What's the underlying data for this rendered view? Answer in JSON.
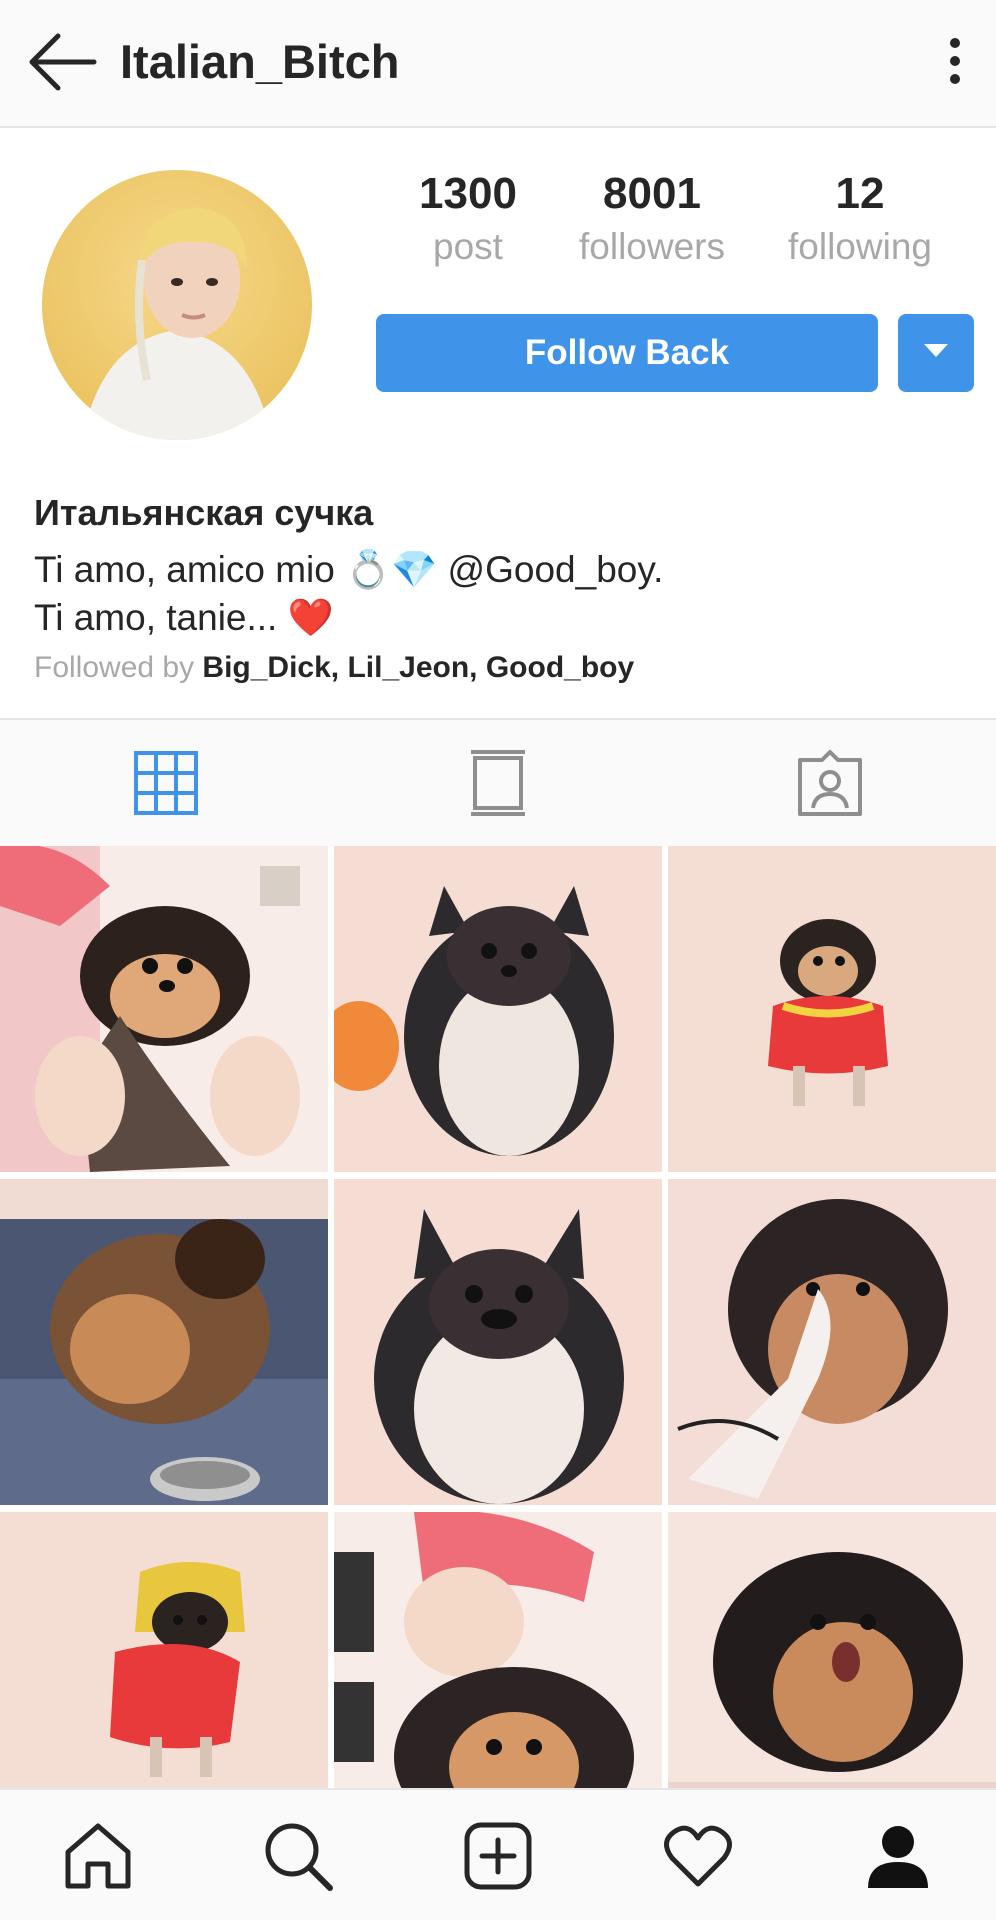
{
  "header": {
    "username": "Italian_Bitch"
  },
  "profile": {
    "stats": [
      {
        "value": "1300",
        "label": "post"
      },
      {
        "value": "8001",
        "label": "followers"
      },
      {
        "value": "12",
        "label": "following"
      }
    ],
    "follow_button_label": "Follow Back",
    "full_name": "Итальянская сучка",
    "bio_line1": "Ti amo, amico mio 💍💎 @Good_boy.",
    "bio_line2": "Ti amo, tanie... ❤️",
    "followed_by_prefix": "Followed by ",
    "followed_by_names": "Big_Dick, Lil_Jeon, Good_boy"
  },
  "tabs": [
    "grid-icon",
    "feed-icon",
    "tagged-icon"
  ],
  "accent_color": "#3f93e8",
  "bottom_nav": [
    "home-icon",
    "search-icon",
    "add-post-icon",
    "heart-icon",
    "profile-icon"
  ]
}
